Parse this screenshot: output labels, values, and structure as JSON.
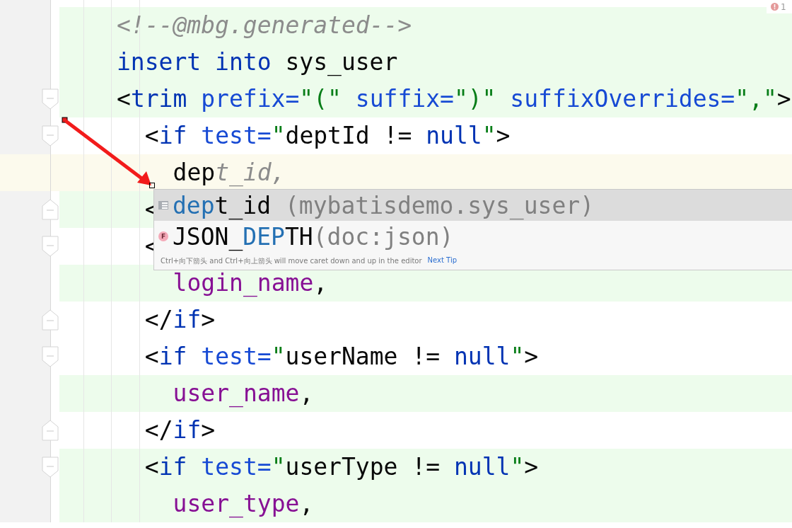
{
  "editor": {
    "lines": [
      {
        "added": true,
        "current": false,
        "tokens": [
          {
            "t": "<!--@mbg.generated-->",
            "kind": "comment"
          }
        ]
      },
      {
        "added": true,
        "current": false,
        "tokens": [
          {
            "t": "insert into",
            "kind": "keyword"
          },
          {
            "t": " sys_user",
            "kind": "text"
          }
        ]
      },
      {
        "added": true,
        "current": false,
        "kind": "fold_start",
        "tokens": [
          {
            "t": "<",
            "kind": "text"
          },
          {
            "t": "trim",
            "kind": "keyword"
          },
          {
            "t": " prefix=",
            "kind": "attr"
          },
          {
            "t": "\"(\"",
            "kind": "string"
          },
          {
            "t": " suffix=",
            "kind": "attr"
          },
          {
            "t": "\")\"",
            "kind": "string"
          },
          {
            "t": " suffixOverrides=",
            "kind": "attr"
          },
          {
            "t": "\",\"",
            "kind": "string"
          },
          {
            "t": ">",
            "kind": "text"
          }
        ],
        "children": [
          {
            "added": false,
            "current": false,
            "kind": "fold_start",
            "tokens": [
              {
                "t": "<",
                "kind": "text"
              },
              {
                "t": "if",
                "kind": "keyword"
              },
              {
                "t": " test=",
                "kind": "attr"
              },
              {
                "t": "\"",
                "kind": "string"
              },
              {
                "t": "deptId != ",
                "kind": "text"
              },
              {
                "t": "null",
                "kind": "keyword"
              },
              {
                "t": "\"",
                "kind": "string"
              },
              {
                "t": ">",
                "kind": "text"
              }
            ],
            "children": [
              {
                "added": false,
                "current": true,
                "tokens": [
                  {
                    "t": "dep",
                    "kind": "text"
                  },
                  {
                    "t": "t_id,",
                    "kind": "hint"
                  }
                ]
              }
            ]
          },
          {
            "added": true,
            "current": false,
            "kind": "fold_end",
            "tokens": [
              {
                "t": "<",
                "kind": "text"
              }
            ]
          },
          {
            "added": false,
            "current": false,
            "kind": "fold_start",
            "tokens": [
              {
                "t": "<",
                "kind": "text"
              }
            ],
            "children": [
              {
                "added": true,
                "current": false,
                "tokens": [
                  {
                    "t": "login_name",
                    "kind": "column"
                  },
                  {
                    "t": ",",
                    "kind": "text"
                  }
                ]
              }
            ]
          },
          {
            "added": false,
            "current": false,
            "kind": "fold_end",
            "tokens": [
              {
                "t": "</",
                "kind": "text"
              },
              {
                "t": "if",
                "kind": "keyword"
              },
              {
                "t": ">",
                "kind": "text"
              }
            ]
          },
          {
            "added": false,
            "current": false,
            "kind": "fold_start",
            "tokens": [
              {
                "t": "<",
                "kind": "text"
              },
              {
                "t": "if",
                "kind": "keyword"
              },
              {
                "t": " test=",
                "kind": "attr"
              },
              {
                "t": "\"",
                "kind": "string"
              },
              {
                "t": "userName != ",
                "kind": "text"
              },
              {
                "t": "null",
                "kind": "keyword"
              },
              {
                "t": "\"",
                "kind": "string"
              },
              {
                "t": ">",
                "kind": "text"
              }
            ],
            "children": [
              {
                "added": true,
                "current": false,
                "tokens": [
                  {
                    "t": "user_name",
                    "kind": "column"
                  },
                  {
                    "t": ",",
                    "kind": "text"
                  }
                ]
              }
            ]
          },
          {
            "added": false,
            "current": false,
            "kind": "fold_end",
            "tokens": [
              {
                "t": "</",
                "kind": "text"
              },
              {
                "t": "if",
                "kind": "keyword"
              },
              {
                "t": ">",
                "kind": "text"
              }
            ]
          },
          {
            "added": true,
            "current": false,
            "kind": "fold_start",
            "tokens": [
              {
                "t": "<",
                "kind": "text"
              },
              {
                "t": "if",
                "kind": "keyword"
              },
              {
                "t": " test=",
                "kind": "attr"
              },
              {
                "t": "\"",
                "kind": "string"
              },
              {
                "t": "userType != ",
                "kind": "text"
              },
              {
                "t": "null",
                "kind": "keyword"
              },
              {
                "t": "\"",
                "kind": "string"
              },
              {
                "t": ">",
                "kind": "text"
              }
            ],
            "children": [
              {
                "added": true,
                "current": false,
                "tokens": [
                  {
                    "t": "user_type",
                    "kind": "column"
                  },
                  {
                    "t": ",",
                    "kind": "text"
                  }
                ]
              }
            ]
          }
        ]
      }
    ]
  },
  "problems": {
    "count": "1"
  },
  "completion": {
    "items": [
      {
        "kind": "column",
        "selected": true,
        "parts": [
          {
            "t": "dep",
            "match": true
          },
          {
            "t": "t_id",
            "match": false
          }
        ],
        "detail": " (mybatisdemo.sys_user)"
      },
      {
        "kind": "function",
        "badge": "F",
        "selected": false,
        "parts": [
          {
            "t": "JSON_",
            "match": false
          },
          {
            "t": "DEP",
            "match": true
          },
          {
            "t": "TH",
            "match": false
          }
        ],
        "detail": "(doc:json)"
      }
    ],
    "tip": "Ctrl+向下箭头 and Ctrl+向上箭头 will move caret down and up in the editor",
    "link": "Next Tip"
  }
}
